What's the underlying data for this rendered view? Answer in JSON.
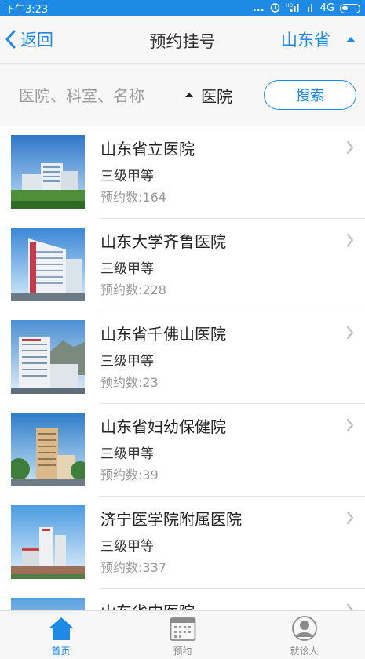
{
  "status_bar": {
    "time": "下午3:23",
    "dots": "...",
    "alarm_icon": "alarm-icon",
    "signal_icon": "signal-icon",
    "network": "4G",
    "battery_icon": "battery-icon"
  },
  "nav": {
    "back_label": "返回",
    "title": "预约挂号",
    "province": "山东省"
  },
  "search": {
    "placeholder": "医院、科室、名称",
    "value": "",
    "type_label": "医院",
    "button_label": "搜索"
  },
  "hospitals": [
    {
      "name": "山东省立医院",
      "level": "三级甲等",
      "count": "预约数:164"
    },
    {
      "name": "山东大学齐鲁医院",
      "level": "三级甲等",
      "count": "预约数:228"
    },
    {
      "name": "山东省千佛山医院",
      "level": "三级甲等",
      "count": "预约数:23"
    },
    {
      "name": "山东省妇幼保健院",
      "level": "三级甲等",
      "count": "预约数:39"
    },
    {
      "name": "济宁医学院附属医院",
      "level": "三级甲等",
      "count": "预约数:337"
    },
    {
      "name": "山东省中医院",
      "level": "",
      "count": ""
    }
  ],
  "tabs": [
    {
      "label": "首页",
      "icon": "home-icon"
    },
    {
      "label": "预约",
      "icon": "calendar-icon"
    },
    {
      "label": "就诊人",
      "icon": "person-icon"
    }
  ],
  "colors": {
    "accent": "#1d8ae6",
    "status_bar": "#1d8ae6"
  }
}
